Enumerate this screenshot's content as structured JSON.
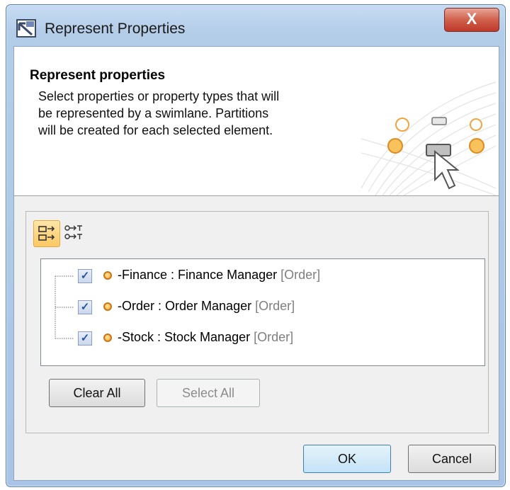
{
  "window": {
    "title": "Represent Properties",
    "close_glyph": "X"
  },
  "header": {
    "title": "Represent properties",
    "description_lines": [
      "Select properties or property types that will",
      "be represented by a swimlane. Partitions",
      "will be created for each selected element."
    ]
  },
  "toolbar": {
    "group_by_properties_icon": "properties-tree-icon",
    "group_by_types_icon": "property-types-icon"
  },
  "properties": [
    {
      "name": "-Finance",
      "sep": " : ",
      "type": "Finance Manager",
      "owner": "[Order]",
      "checked": true
    },
    {
      "name": "-Order",
      "sep": " : ",
      "type": "Order Manager",
      "owner": "[Order]",
      "checked": true
    },
    {
      "name": "-Stock",
      "sep": " : ",
      "type": "Stock Manager",
      "owner": "[Order]",
      "checked": true
    }
  ],
  "buttons": {
    "clear_all": "Clear All",
    "select_all": "Select All",
    "ok": "OK",
    "cancel": "Cancel"
  },
  "check_glyph": "✓"
}
